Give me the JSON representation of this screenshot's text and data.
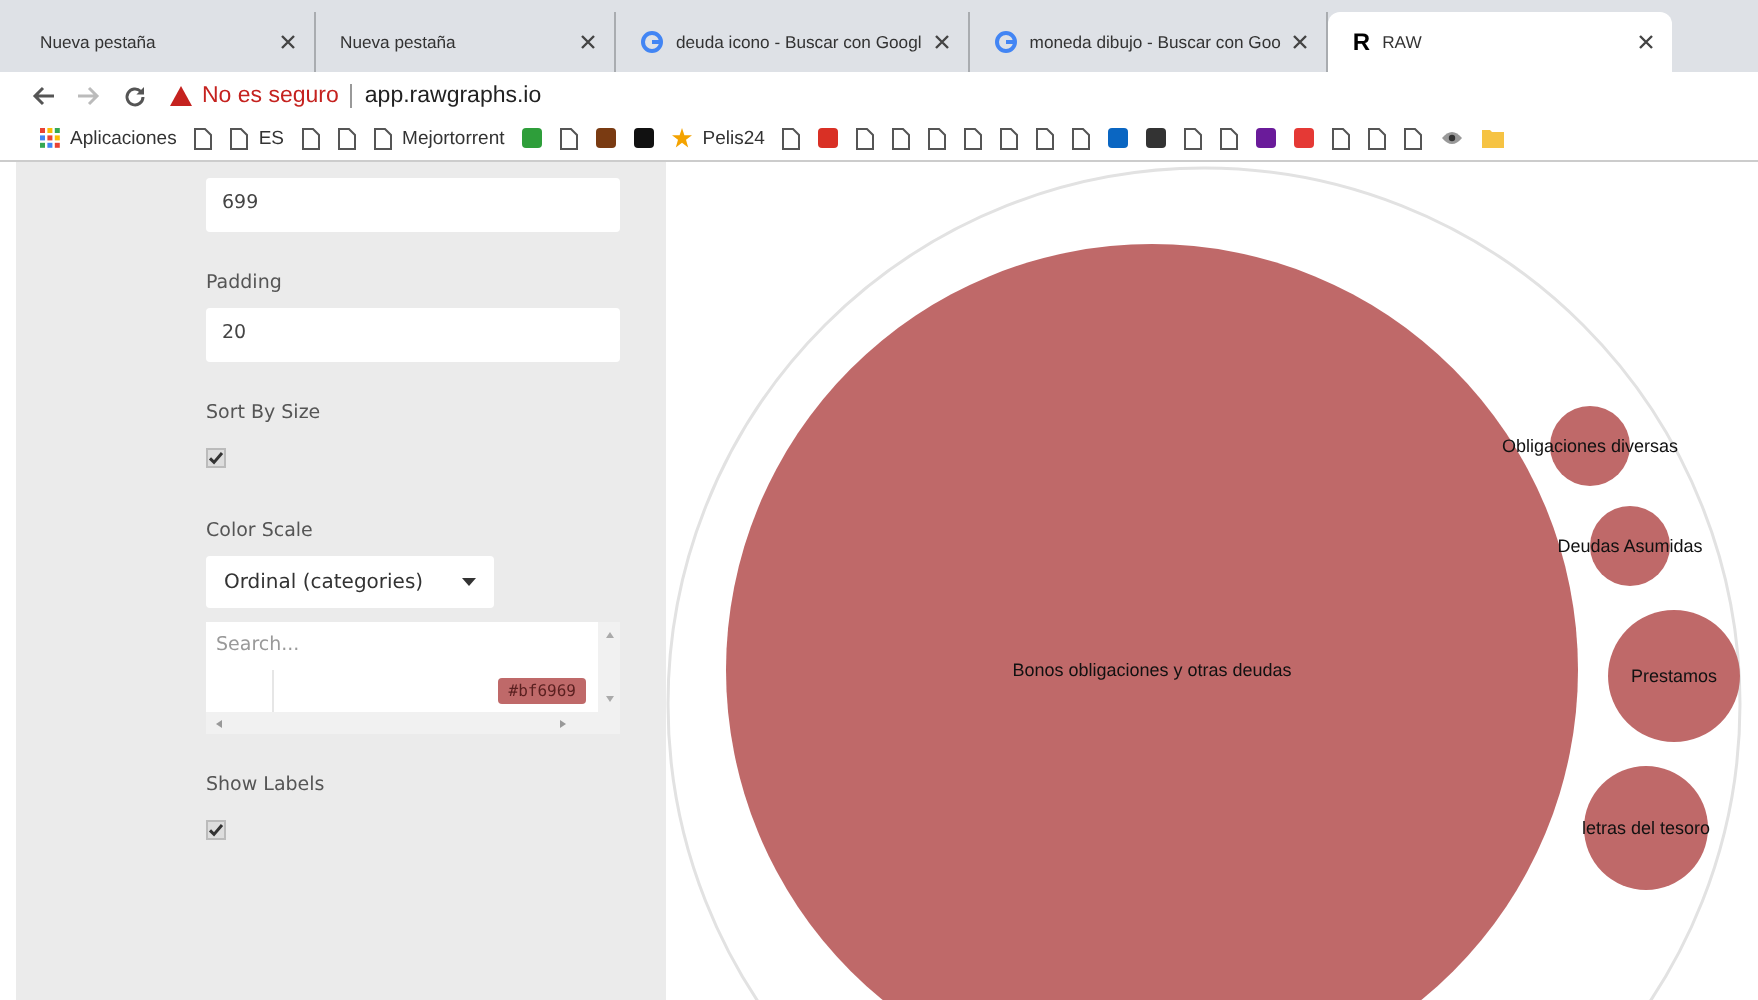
{
  "tabs": [
    {
      "title": "Nueva pestaña",
      "kind": "plain",
      "selected": false
    },
    {
      "title": "Nueva pestaña",
      "kind": "plain",
      "selected": false
    },
    {
      "title": "deuda icono - Buscar con Googl",
      "kind": "google",
      "selected": false
    },
    {
      "title": "moneda dibujo - Buscar con Goo",
      "kind": "google",
      "selected": false
    },
    {
      "title": "RAW",
      "kind": "logo",
      "logo": "R",
      "selected": true
    }
  ],
  "address": {
    "warning": "No es seguro",
    "url": "app.rawgraphs.io"
  },
  "bookmarks": [
    {
      "kind": "apps",
      "label": "Aplicaciones"
    },
    {
      "kind": "page"
    },
    {
      "kind": "page",
      "label": "ES"
    },
    {
      "kind": "page"
    },
    {
      "kind": "page"
    },
    {
      "kind": "page",
      "label": "Mejortorrent"
    },
    {
      "kind": "badge",
      "color": "#2e9e3a"
    },
    {
      "kind": "page"
    },
    {
      "kind": "badge",
      "color": "#7a3b12"
    },
    {
      "kind": "badge",
      "color": "#111111"
    },
    {
      "kind": "star",
      "label": "Pelis24"
    },
    {
      "kind": "page"
    },
    {
      "kind": "badge",
      "color": "#d93025"
    },
    {
      "kind": "page"
    },
    {
      "kind": "page"
    },
    {
      "kind": "page"
    },
    {
      "kind": "page"
    },
    {
      "kind": "page"
    },
    {
      "kind": "page"
    },
    {
      "kind": "page"
    },
    {
      "kind": "badge",
      "color": "#0a66c2"
    },
    {
      "kind": "badge",
      "color": "#333333"
    },
    {
      "kind": "page"
    },
    {
      "kind": "page"
    },
    {
      "kind": "badge",
      "color": "#6a1b9a"
    },
    {
      "kind": "badge",
      "color": "#e53935"
    },
    {
      "kind": "page"
    },
    {
      "kind": "page"
    },
    {
      "kind": "page"
    },
    {
      "kind": "eye"
    },
    {
      "kind": "folder"
    }
  ],
  "settings": [
    {
      "kind": "input",
      "value": "699"
    },
    {
      "kind": "input",
      "label": "Padding",
      "value": "20"
    },
    {
      "kind": "checkbox",
      "label": "Sort By Size",
      "checked": true
    },
    {
      "kind": "select",
      "label": "Color Scale",
      "value": "Ordinal (categories)"
    },
    {
      "kind": "colorlist",
      "placeholder": "Search...",
      "swatch": {
        "text": "#bf6969",
        "color": "#bf6969"
      }
    },
    {
      "kind": "checkbox",
      "label": "Show Labels",
      "checked": true
    }
  ],
  "chart": {
    "bubbles": [
      {
        "label": "Bonos obligaciones y otras deudas"
      },
      {
        "label": "Obligaciones diversas"
      },
      {
        "label": "Deudas Asumidas"
      },
      {
        "label": "Prestamos"
      },
      {
        "label": "letras del tesoro"
      }
    ]
  }
}
